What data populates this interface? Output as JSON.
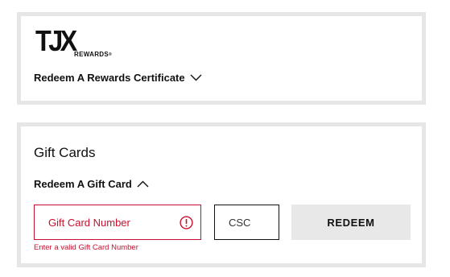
{
  "rewards": {
    "logo_text": "TJX",
    "logo_subtext": "REWARDS",
    "logo_reg": "®",
    "redeem_certificate_label": "Redeem A Rewards Certificate",
    "toggle_icon": "chevron-down-icon"
  },
  "gift_cards": {
    "title": "Gift Cards",
    "redeem_label": "Redeem A Gift Card",
    "toggle_icon": "chevron-up-icon",
    "card_number_placeholder": "Gift Card Number",
    "card_number_value": "",
    "csc_placeholder": "CSC",
    "csc_value": "",
    "redeem_button": "REDEEM",
    "error_message": "Enter a valid Gift Card Number"
  },
  "colors": {
    "panel_border": "#e6e6e6",
    "error": "#c8102e",
    "button_bg": "#e8e8e8",
    "text": "#111111"
  }
}
